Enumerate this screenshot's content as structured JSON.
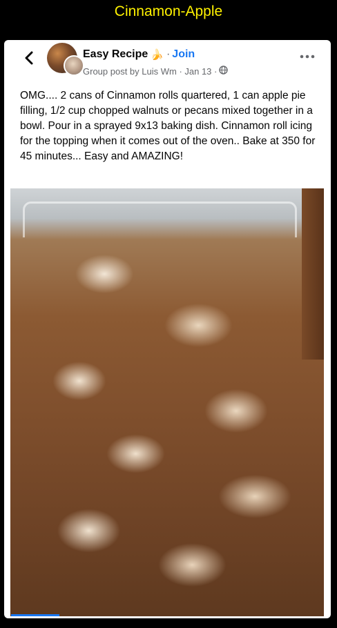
{
  "banner": {
    "title": "Cinnamon-Apple"
  },
  "post": {
    "group_name": "Easy Recipe",
    "group_emoji": "🍌",
    "separator": "·",
    "join_label": "Join",
    "subtitle": "Group post by Luis Wm · Jan 13 ·",
    "body": "OMG.... 2 cans of Cinnamon rolls quartered, 1 can apple pie filling, 1/2 cup chopped walnuts or pecans mixed together in a bowl. Pour in a sprayed 9x13 baking dish. Cinnamon roll icing for the topping when it comes out of the oven.. Bake at 350 for 45 minutes... Easy and AMAZING!"
  },
  "icons": {
    "back": "chevron-left-icon",
    "more": "more-horizontal-icon",
    "privacy": "globe-icon"
  },
  "colors": {
    "banner_text": "#fff200",
    "link": "#1877f2",
    "secondary_text": "#65676b"
  }
}
